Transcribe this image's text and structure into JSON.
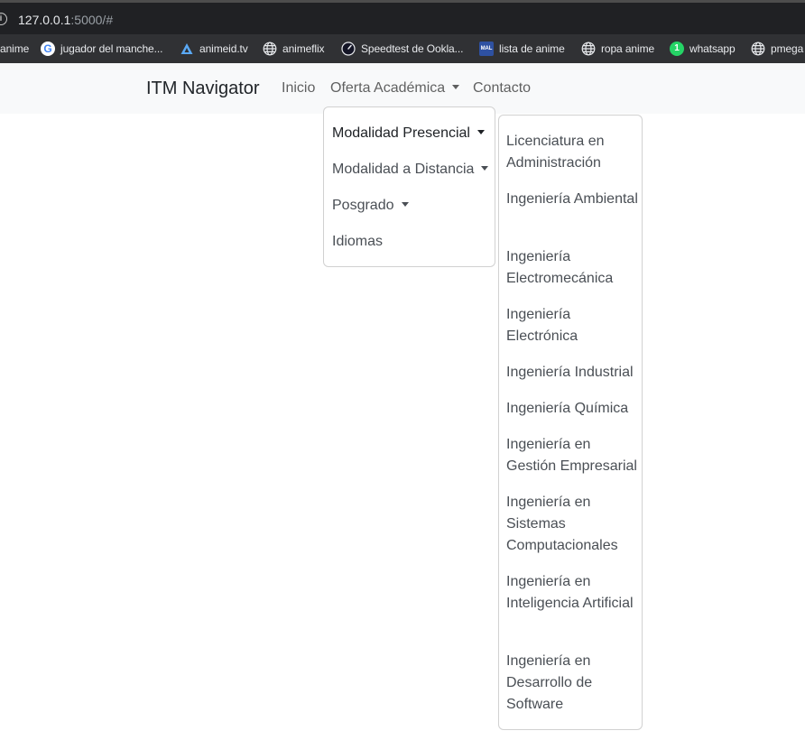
{
  "browser": {
    "url_host": "127.0.0.1",
    "url_rest": ":5000/#",
    "bookmarks": [
      {
        "label": "anime",
        "icon": "none"
      },
      {
        "label": "jugador del manche...",
        "icon": "google-icon"
      },
      {
        "label": "animeid.tv",
        "icon": "animeid-icon"
      },
      {
        "label": "animeflix",
        "icon": "globe-icon"
      },
      {
        "label": "Speedtest de Ookla...",
        "icon": "speedtest-icon"
      },
      {
        "label": "lista de anime",
        "icon": "mal-icon"
      },
      {
        "label": "ropa anime",
        "icon": "globe-icon"
      },
      {
        "label": "whatsapp",
        "icon": "whatsapp-icon"
      },
      {
        "label": "pmega",
        "icon": "globe-icon"
      }
    ]
  },
  "navbar": {
    "brand": "ITM Navigator",
    "links": {
      "inicio": "Inicio",
      "oferta": "Oferta Académica",
      "contacto": "Contacto"
    }
  },
  "dropdown": {
    "items": [
      "Modalidad Presencial",
      "Modalidad a Distancia",
      "Posgrado",
      "Idiomas"
    ]
  },
  "submenu": {
    "items": [
      "Licenciatura en Administración",
      "Ingeniería Ambiental",
      "Ingeniería Electromecánica",
      "Ingeniería Electrónica",
      "Ingeniería Industrial",
      "Ingeniería Química",
      "Ingeniería en Gestión Empresarial",
      "Ingeniería en Sistemas Computacionales",
      "Ingeniería en Inteligencia Artificial",
      "Ingeniería en Desarrollo de Software"
    ]
  },
  "colors": {
    "chrome_dark": "#202124",
    "bookmarks_bar": "#303134",
    "navbar_bg": "#f8f9fa",
    "whatsapp_green": "#25d366",
    "mal_blue": "#2e51a2"
  }
}
